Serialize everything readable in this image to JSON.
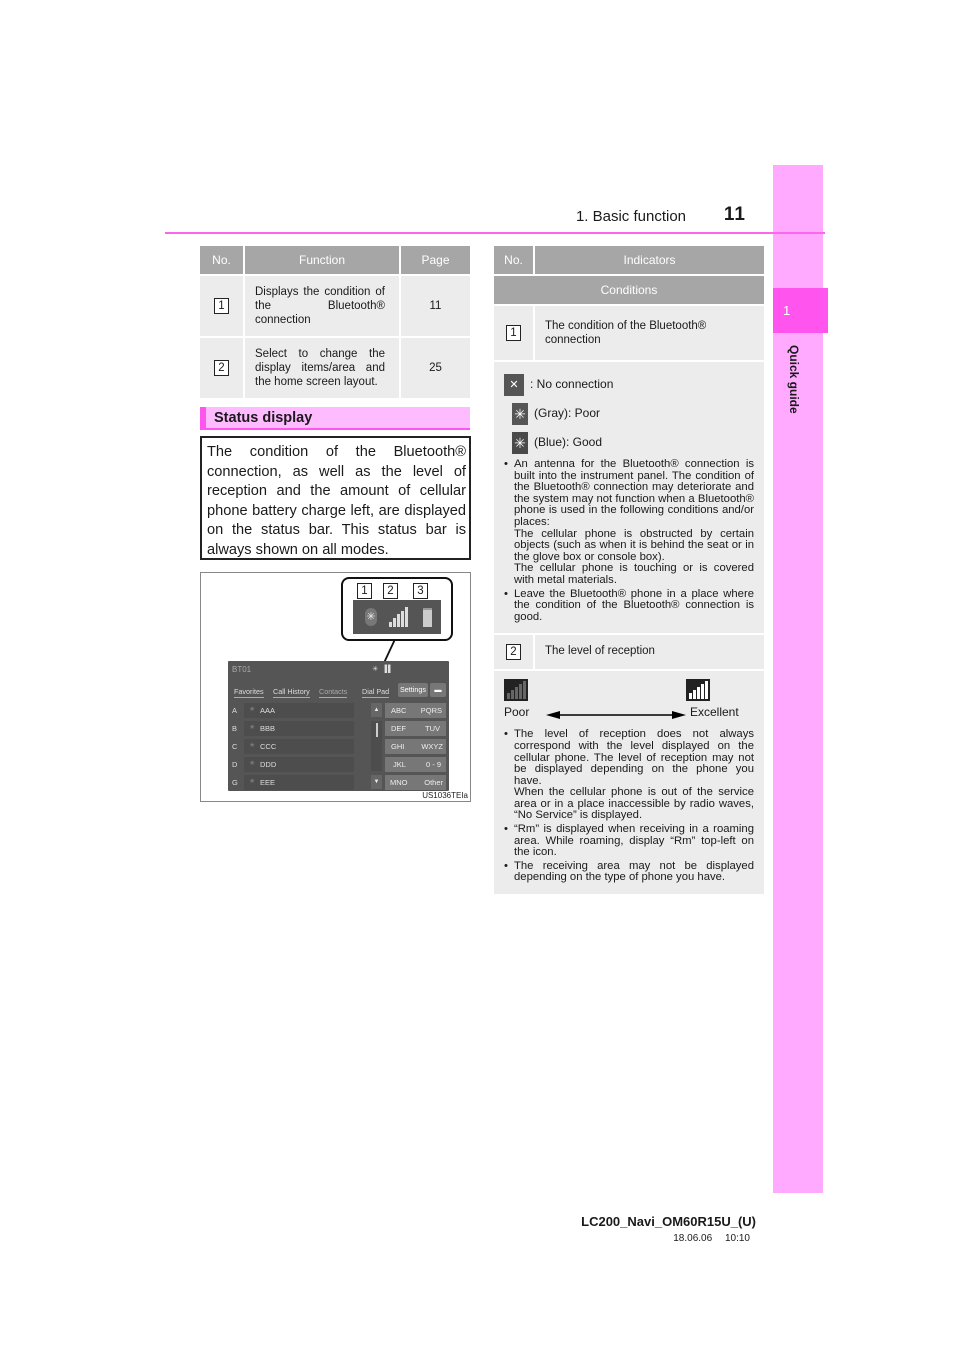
{
  "header": {
    "section_title": "1. Basic function",
    "page_number": "11"
  },
  "side_tab": {
    "chapter_number": "1",
    "chapter_label": "Quick guide"
  },
  "function_table": {
    "headers": [
      "No.",
      "Function",
      "Page"
    ],
    "rows": [
      {
        "no": "1",
        "function": "Displays the condition of the Bluetooth® connection",
        "page": "11"
      },
      {
        "no": "2",
        "function": "Select to change the display items/area and the home screen layout.",
        "page": "25"
      }
    ]
  },
  "status_display": {
    "heading": "Status display",
    "description": "The condition of the Bluetooth® connection, as well as the level of reception and the amount of cellular phone battery charge left, are displayed on the status bar. This status bar is always shown on all modes."
  },
  "figure": {
    "callout_numbers": [
      "1",
      "2",
      "3"
    ],
    "screen_title": "BT01",
    "tabs": [
      "Favorites",
      "Call History",
      "Contacts",
      "Dial Pad"
    ],
    "settings_label": "Settings",
    "contacts": [
      {
        "letter": "A",
        "name": "AAA"
      },
      {
        "letter": "B",
        "name": "BBB"
      },
      {
        "letter": "C",
        "name": "CCC"
      },
      {
        "letter": "D",
        "name": "DDD"
      },
      {
        "letter": "G",
        "name": "EEE"
      }
    ],
    "keypad": [
      [
        "ABC",
        "PQRS"
      ],
      [
        "DEF",
        "TUV"
      ],
      [
        "GHI",
        "WXYZ"
      ],
      [
        "JKL",
        "0 - 9"
      ],
      [
        "MNO",
        "Other"
      ]
    ],
    "code": "US1036TEIa"
  },
  "indicator_table": {
    "headers": [
      "No.",
      "Indicators"
    ],
    "conditions_header": "Conditions",
    "item1": {
      "no": "1",
      "title": "The condition of the Bluetooth® connection",
      "indicators": [
        {
          "icon": "no-connection-icon",
          "label": ": No connection"
        },
        {
          "icon": "bluetooth-gray-icon",
          "label": "(Gray): Poor"
        },
        {
          "icon": "bluetooth-blue-icon",
          "label": "(Blue): Good"
        }
      ],
      "bullets": [
        "An antenna for the Bluetooth® connection is built into the instrument panel. The condition of the Bluetooth® connection may deteriorate and the system may not function when a Bluetooth® phone is used in the following conditions and/or places:",
        "Leave the Bluetooth® phone in a place where the condition of the Bluetooth® connection is good."
      ],
      "sub_lines": [
        "The cellular phone is obstructed by certain objects (such as when it is behind the seat or in the glove box or console box).",
        "The cellular phone is touching or is covered with metal materials."
      ]
    },
    "item2": {
      "no": "2",
      "title": "The level of reception",
      "scale_low": "Poor",
      "scale_high": "Excellent",
      "bullets": [
        "The level of reception does not always correspond with the level displayed on the cellular phone. The level of reception may not be displayed depending on the phone you have.",
        "“Rm” is displayed when receiving in a roaming area. While roaming, display “Rm” top-left on the icon.",
        "The receiving area may not be displayed depending on the type of phone you have."
      ],
      "bullet1_continuation": "When the cellular phone is out of the service area or in a place inaccessible by radio waves, “No Service” is displayed."
    }
  },
  "footer": {
    "doc_id": "LC200_Navi_OM60R15U_(U)",
    "date": "18.06.06",
    "time": "10:10"
  }
}
